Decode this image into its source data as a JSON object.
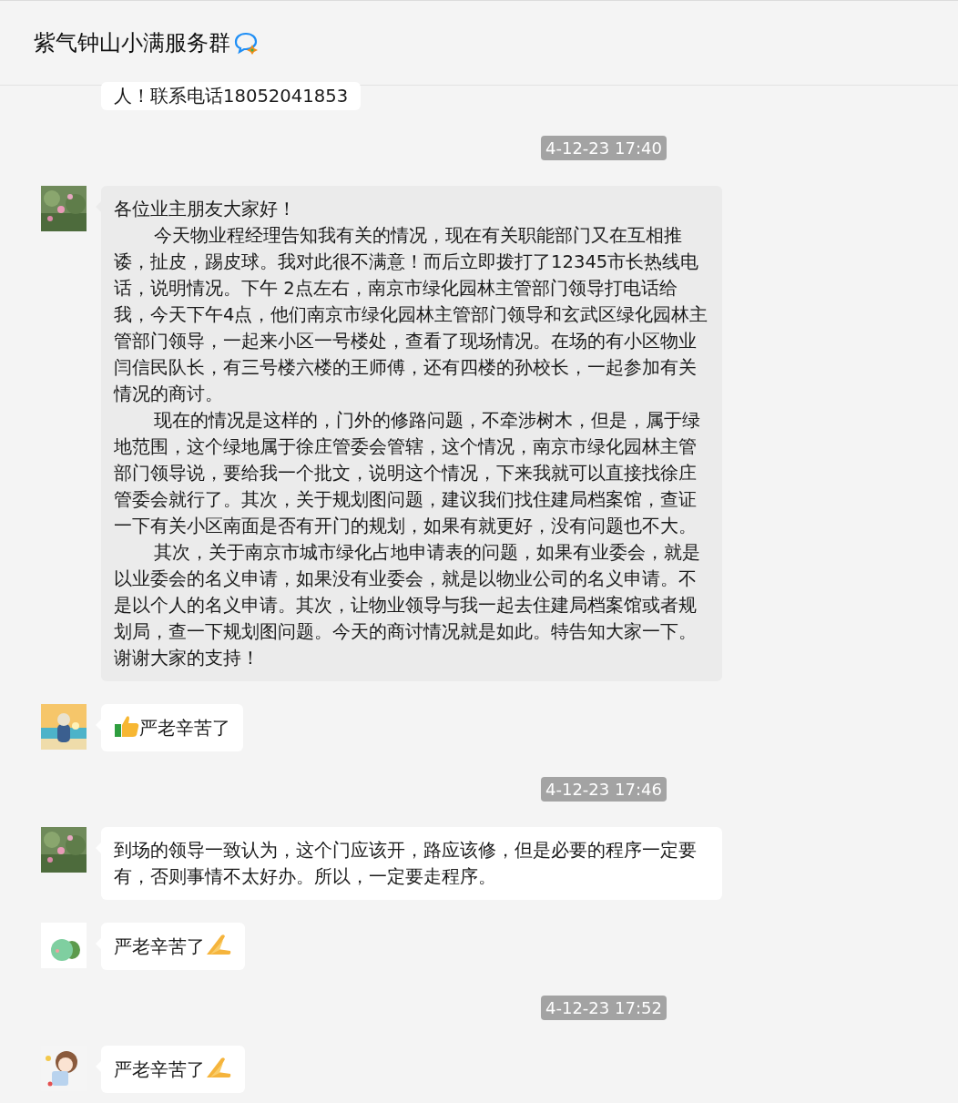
{
  "header": {
    "title": "紫气钟山小满服务群"
  },
  "items": [
    {
      "kind": "message",
      "highlighted": false,
      "paragraphs": [
        {
          "text": "人！联系电话18052041853",
          "indent": false
        }
      ]
    },
    {
      "kind": "time",
      "text": "4-12-23 17:40"
    },
    {
      "kind": "message",
      "highlighted": true,
      "paragraphs": [
        {
          "text": "各位业主朋友大家好！",
          "indent": false
        },
        {
          "text": "今天物业程经理告知我有关的情况，现在有关职能部门又在互相推诿，扯皮，踢皮球。我对此很不满意！而后立即拨打了12345市长热线电话，说明情况。下午 2点左右，南京市绿化园林主管部门领导打电话给我，今天下午4点，他们南京市绿化园林主管部门领导和玄武区绿化园林主管部门领导，一起来小区一号楼处，查看了现场情况。在场的有小区物业闫信民队长，有三号楼六楼的王师傅，还有四楼的孙校长，一起参加有关情况的商讨。",
          "indent": true
        },
        {
          "text": "现在的情况是这样的，门外的修路问题，不牵涉树木，但是，属于绿地范围，这个绿地属于徐庄管委会管辖，这个情况，南京市绿化园林主管部门领导说，要给我一个批文，说明这个情况，下来我就可以直接找徐庄管委会就行了。其次，关于规划图问题，建议我们找住建局档案馆，查证一下有关小区南面是否有开门的规划，如果有就更好，没有问题也不大。",
          "indent": true
        },
        {
          "text": "其次，关于南京市城市绿化占地申请表的问题，如果有业委会，就是以业委会的名义申请，如果没有业委会，就是以物业公司的名义申请。不是以个人的名义申请。其次，让物业领导与我一起去住建局档案馆或者规划局，查一下规划图问题。今天的商讨情况就是如此。特告知大家一下。谢谢大家的支持！",
          "indent": true
        }
      ]
    },
    {
      "kind": "praise",
      "highlighted": false,
      "paragraphs": [
        {
          "text": "严老辛苦了",
          "indent": false
        }
      ]
    },
    {
      "kind": "time",
      "text": "4-12-23 17:46"
    },
    {
      "kind": "message",
      "highlighted": false,
      "paragraphs": [
        {
          "text": "到场的领导一致认为，这个门应该开，路应该修，但是必要的程序一定要有，否则事情不太好办。所以，一定要走程序。",
          "indent": false
        }
      ]
    },
    {
      "kind": "thanks",
      "highlighted": false,
      "paragraphs": [
        {
          "text": "严老辛苦了",
          "indent": false
        }
      ]
    },
    {
      "kind": "time",
      "text": "4-12-23 17:52"
    },
    {
      "kind": "thanks",
      "highlighted": false,
      "paragraphs": [
        {
          "text": "严老辛苦了",
          "indent": false
        }
      ]
    }
  ]
}
